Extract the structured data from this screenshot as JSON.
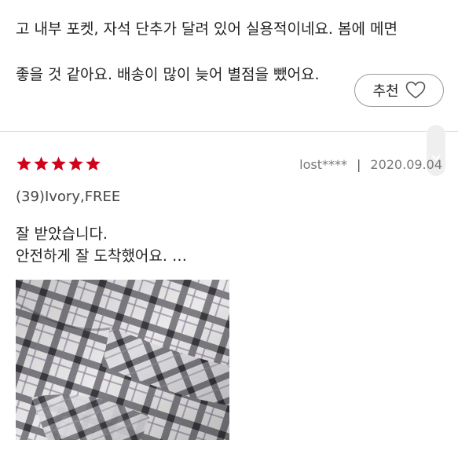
{
  "previous_review": {
    "line1": "고 내부 포켓, 자석 단추가 달려 있어 실용적이네요. 봄에 메면",
    "line2": "좋을 것 같아요. 배송이 많이 늦어 별점을 뺐어요."
  },
  "recommend_button": {
    "label": "추천",
    "icon": "heart-outline-icon"
  },
  "scroll_buttons": {
    "up_icon": "chevron-up-icon",
    "down_icon": "chevron-down-icon"
  },
  "review": {
    "rating": 5,
    "max_rating": 5,
    "star_color": "#d0021b",
    "author": "lost****",
    "separator": "|",
    "date": "2020.09.04",
    "option": "(39)Ivory,FREE",
    "body_line1": "잘 받았습니다.",
    "body_line2": "안전하게 잘 도착했어요. …",
    "photo_icon": "plaid-fabric-photo"
  }
}
